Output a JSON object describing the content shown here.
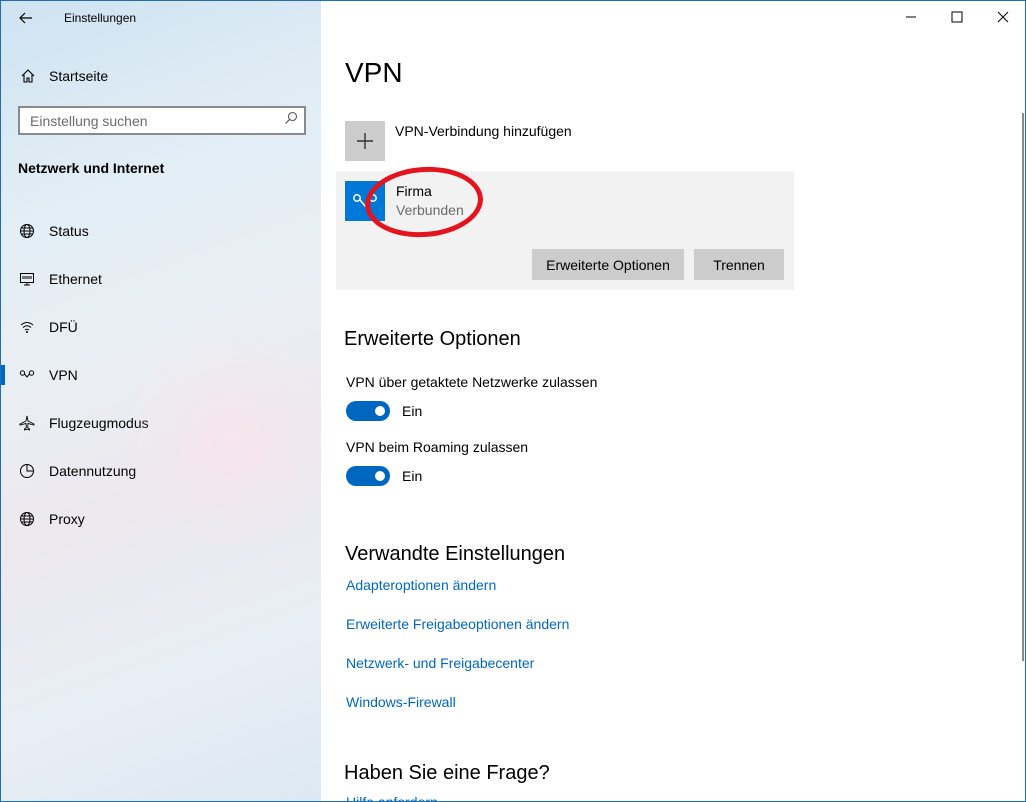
{
  "window": {
    "app_title": "Einstellungen"
  },
  "sidebar": {
    "home_label": "Startseite",
    "search_placeholder": "Einstellung suchen",
    "section_title": "Netzwerk und Internet",
    "items": [
      {
        "label": "Status",
        "icon": "globe-icon",
        "active": false
      },
      {
        "label": "Ethernet",
        "icon": "ethernet-icon",
        "active": false
      },
      {
        "label": "DFÜ",
        "icon": "dialup-icon",
        "active": false
      },
      {
        "label": "VPN",
        "icon": "vpn-icon",
        "active": true
      },
      {
        "label": "Flugzeugmodus",
        "icon": "airplane-icon",
        "active": false
      },
      {
        "label": "Datennutzung",
        "icon": "data-usage-icon",
        "active": false
      },
      {
        "label": "Proxy",
        "icon": "globe-icon",
        "active": false
      }
    ]
  },
  "main": {
    "title": "VPN",
    "add_connection_label": "VPN-Verbindung hinzufügen",
    "connection": {
      "name": "Firma",
      "status": "Verbunden",
      "advanced_button": "Erweiterte Optionen",
      "disconnect_button": "Trennen"
    },
    "advanced": {
      "heading": "Erweiterte Optionen",
      "metered_label": "VPN über getaktete Netzwerke zulassen",
      "metered_state": "Ein",
      "roaming_label": "VPN beim Roaming zulassen",
      "roaming_state": "Ein"
    },
    "related": {
      "heading": "Verwandte Einstellungen",
      "links": [
        "Adapteroptionen ändern",
        "Erweiterte Freigabeoptionen ändern",
        "Netzwerk- und Freigabecenter",
        "Windows-Firewall"
      ]
    },
    "question_heading": "Haben Sie eine Frage?",
    "help_link": "Hilfe anfordern"
  },
  "colors": {
    "accent": "#0067c0",
    "vpn_tile": "#0078d7",
    "annotation": "#e3141e"
  }
}
